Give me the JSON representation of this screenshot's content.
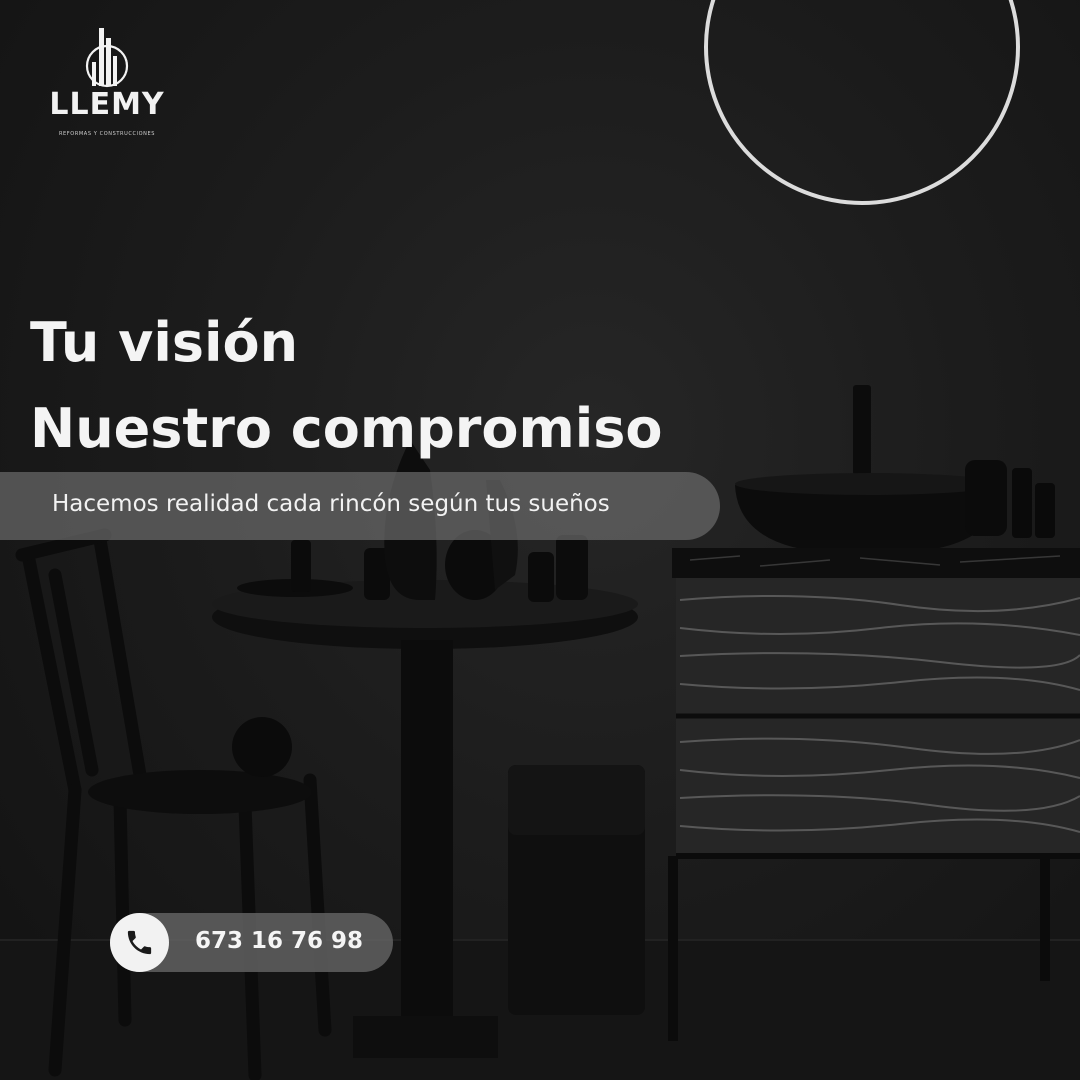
{
  "brand": {
    "name": "LLEMY",
    "tagline": "REFORMAS Y CONSTRUCCIONES",
    "logo_icon": "building-logo-icon"
  },
  "headline": {
    "line1": "Tu visión",
    "line2": "Nuestro compromiso"
  },
  "subtitle": "Hacemos realidad cada rincón según tus sueños",
  "contact": {
    "phone": "673 16 76 98",
    "icon": "phone-icon"
  },
  "colors": {
    "background": "#1c1c1c",
    "text": "#f4f4f4",
    "pill": "#696969",
    "phone_circle": "#f2f2f2"
  }
}
